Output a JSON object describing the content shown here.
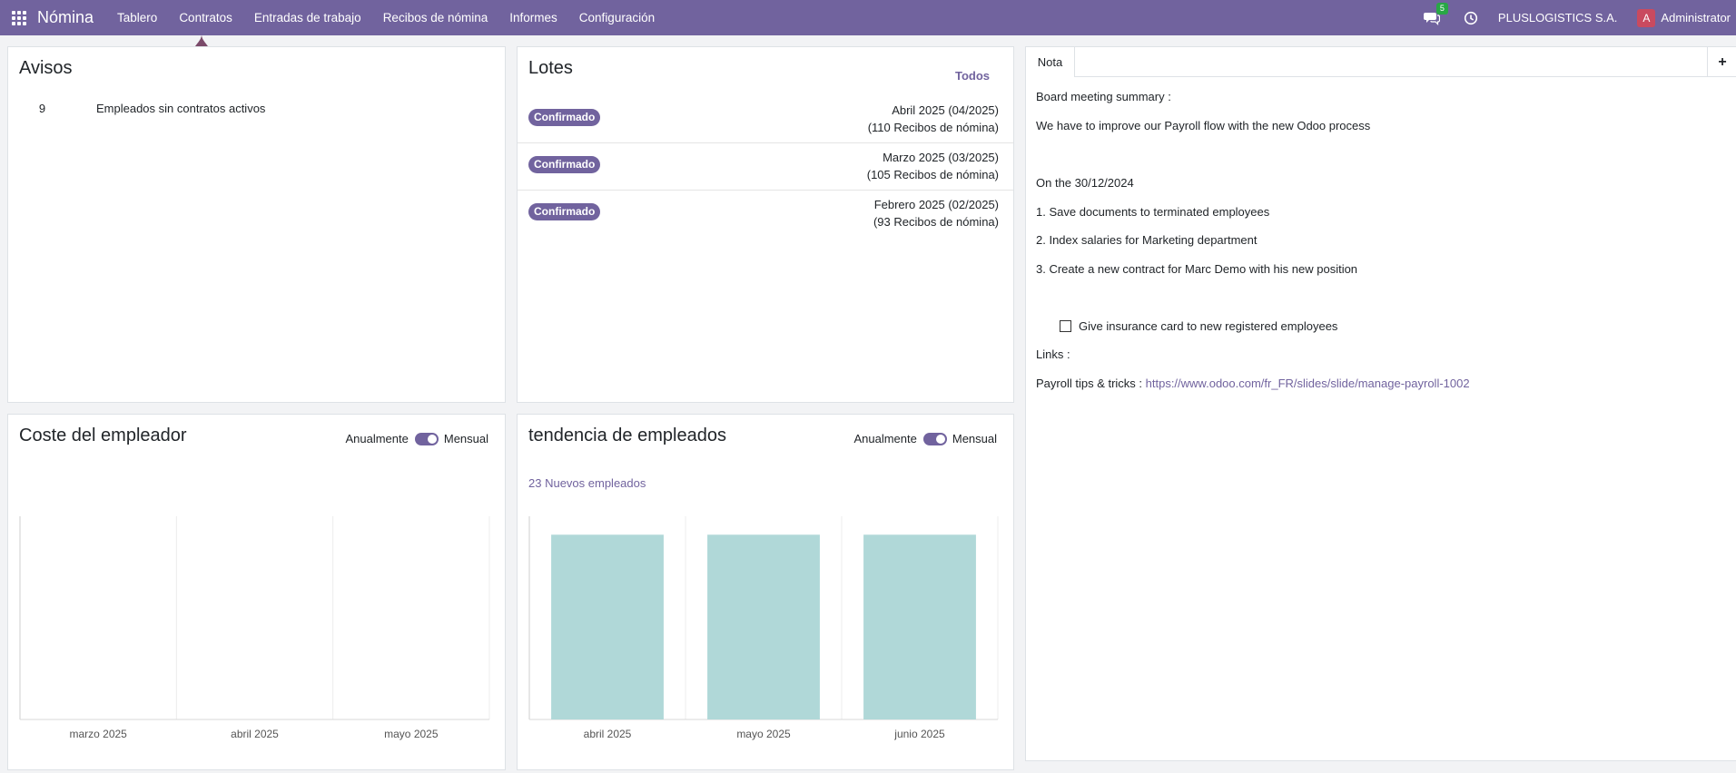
{
  "topbar": {
    "app_name": "Nómina",
    "menu": [
      "Tablero",
      "Contratos",
      "Entradas de trabajo",
      "Recibos de nómina",
      "Informes",
      "Configuración"
    ],
    "chat_badge": "5",
    "company": "PLUSLOGISTICS S.A.",
    "avatar_letter": "A",
    "username": "Administrator",
    "colors": {
      "bar": "#71639e",
      "badge": "#28a745",
      "avatar": "#c94a5f"
    }
  },
  "avisos": {
    "title": "Avisos",
    "rows": [
      {
        "count": "9",
        "label": "Empleados sin contratos activos"
      }
    ]
  },
  "lotes": {
    "title": "Lotes",
    "all_link": "Todos",
    "rows": [
      {
        "status": "Confirmado",
        "period": "Abril 2025 (04/2025)",
        "count": "(110 Recibos de nómina)"
      },
      {
        "status": "Confirmado",
        "period": "Marzo 2025 (03/2025)",
        "count": "(105 Recibos de nómina)"
      },
      {
        "status": "Confirmado",
        "period": "Febrero 2025 (02/2025)",
        "count": "(93 Recibos de nómina)"
      }
    ]
  },
  "coste": {
    "title": "Coste del empleador",
    "toggle_left": "Anualmente",
    "toggle_right": "Mensual"
  },
  "tendencia": {
    "title": "tendencia de empleados",
    "toggle_left": "Anualmente",
    "toggle_right": "Mensual",
    "subtitle": "23 Nuevos empleados"
  },
  "nota": {
    "tab": "Nota",
    "add": "+",
    "lines": {
      "l1": "Board meeting summary :",
      "l2": "We have to improve our Payroll flow with the new Odoo process",
      "l3": "On the 30/12/2024",
      "l4": "1. Save documents to terminated employees",
      "l5": "2. Index salaries for Marketing department",
      "l6": "3. Create a new contract for Marc Demo with his new position",
      "l7": "Give insurance card to new registered employees",
      "l8": "Links :",
      "l9_prefix": "Payroll tips & tricks : ",
      "l9_link": "https://www.odoo.com/fr_FR/slides/slide/manage-payroll-1002"
    }
  },
  "chart_data": [
    {
      "type": "bar",
      "categories": [
        "marzo 2025",
        "abril 2025",
        "mayo 2025"
      ],
      "values": [
        0,
        0,
        0
      ],
      "color": "#b0d8d8"
    },
    {
      "type": "bar",
      "categories": [
        "abril 2025",
        "mayo 2025",
        "junio 2025"
      ],
      "values": [
        1,
        1,
        1
      ],
      "ylim": [
        0,
        1.1
      ],
      "color": "#b0d8d8"
    }
  ]
}
